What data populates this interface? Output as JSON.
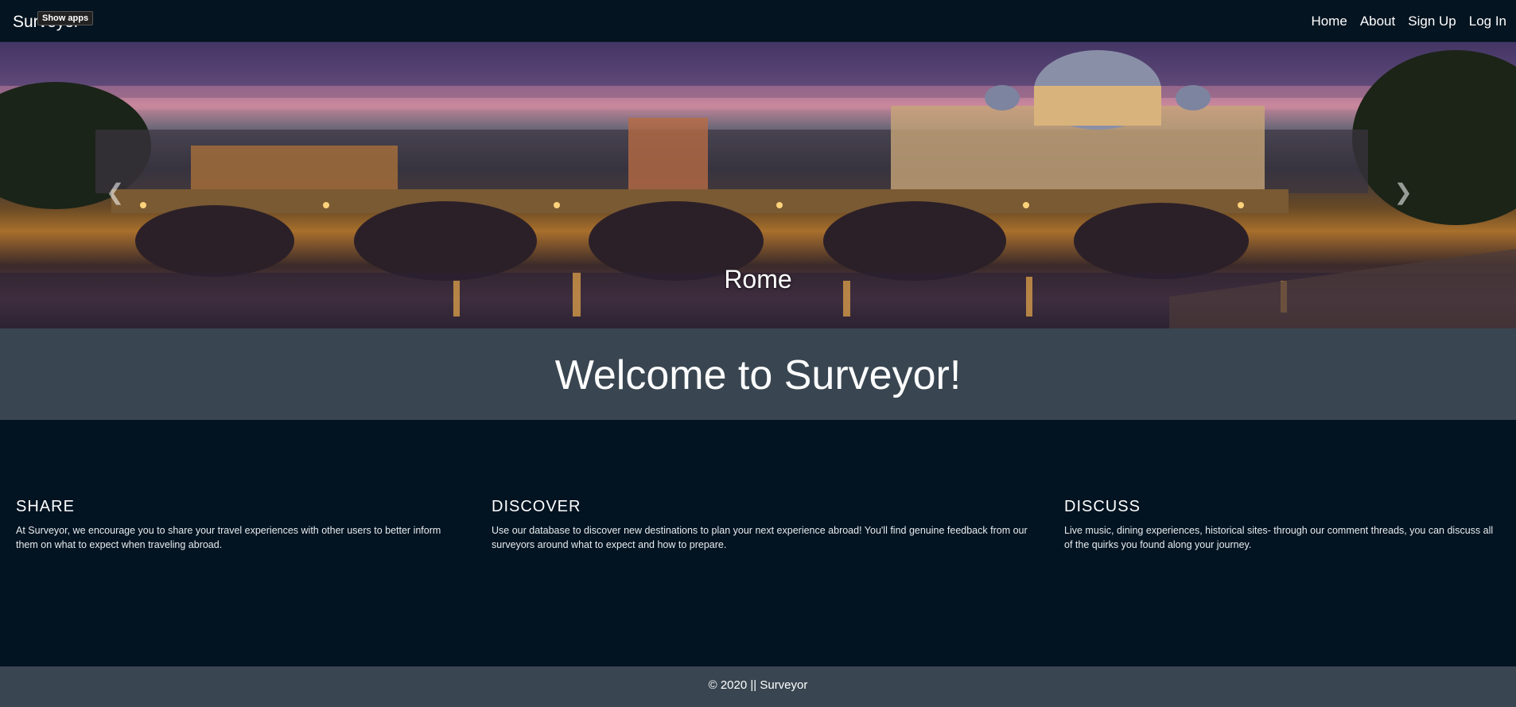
{
  "nav": {
    "brand": "Surveyor",
    "show_apps": "Show apps",
    "links": [
      "Home",
      "About",
      "Sign Up",
      "Log In"
    ]
  },
  "hero": {
    "caption": "Rome",
    "prev_icon": "chevron-left-icon",
    "next_icon": "chevron-right-icon"
  },
  "welcome": {
    "title": "Welcome to Surveyor!"
  },
  "features": [
    {
      "title": "SHARE",
      "text": "At Surveyor, we encourage you to share your travel experiences with other users to better inform them on what to expect when traveling abroad."
    },
    {
      "title": "DISCOVER",
      "text": "Use our database to discover new destinations to plan your next experience abroad! You'll find genuine feedback from our surveyors around what to expect and how to prepare."
    },
    {
      "title": "DISCUSS",
      "text": "Live music, dining experiences, historical sites- through our comment threads, you can discuss all of the quirks you found along your journey."
    }
  ],
  "footer": {
    "text": "© 2020 || Surveyor"
  },
  "colors": {
    "nav_bg": "#041420",
    "band_bg": "#394651",
    "page_bg": "#021321"
  }
}
